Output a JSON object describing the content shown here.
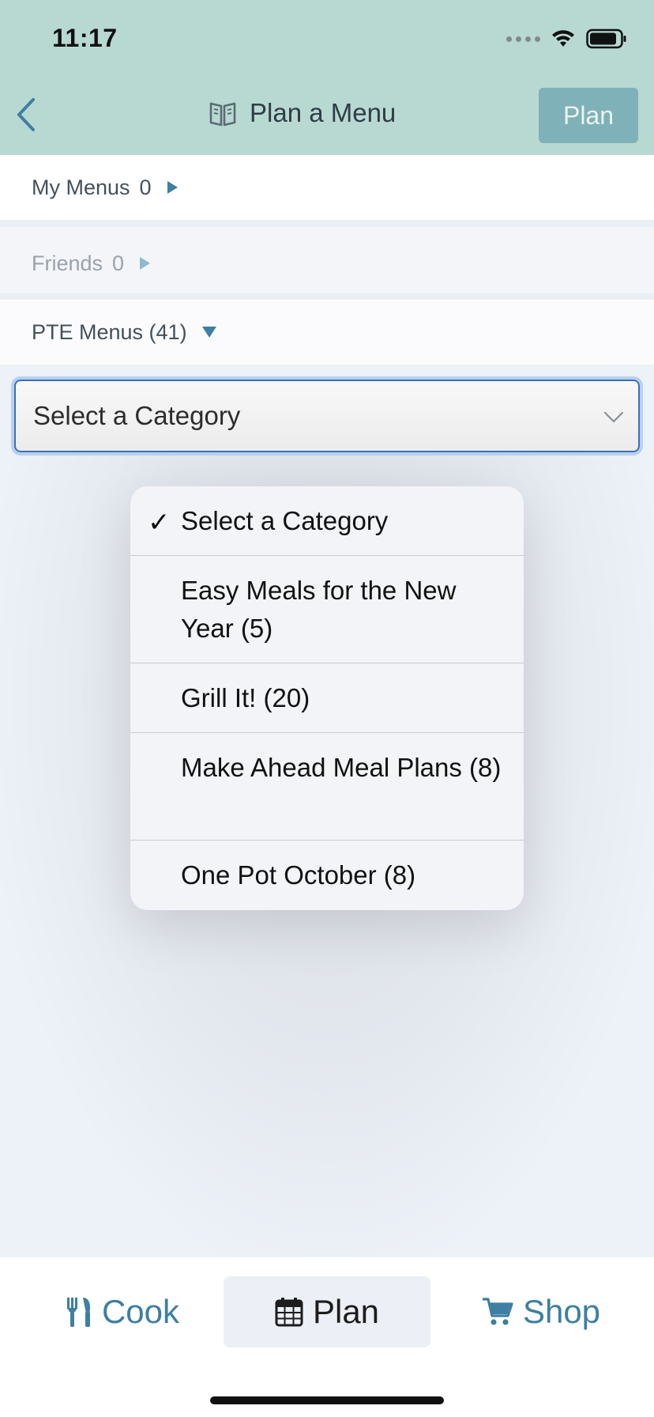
{
  "status_bar": {
    "time": "11:17"
  },
  "nav": {
    "title": "Plan a Menu",
    "plan_button": "Plan"
  },
  "sections": {
    "my_menus": {
      "label": "My Menus",
      "count": "0"
    },
    "friends": {
      "label": "Friends",
      "count": "0"
    },
    "pte_menus": {
      "label": "PTE Menus (41)"
    }
  },
  "category_select": {
    "value": "Select a Category"
  },
  "dropdown": {
    "items": [
      {
        "label": "Select a Category",
        "selected": true
      },
      {
        "label": "Easy Meals for the New Year (5)",
        "selected": false
      },
      {
        "label": "Grill It! (20)",
        "selected": false
      },
      {
        "label": "Make Ahead Meal Plans (8)",
        "selected": false
      },
      {
        "label": "One Pot October (8)",
        "selected": false
      }
    ]
  },
  "tabs": [
    {
      "label": "Cook",
      "icon": "utensils-icon"
    },
    {
      "label": "Plan",
      "icon": "calendar-icon",
      "active": true
    },
    {
      "label": "Shop",
      "icon": "cart-icon"
    }
  ],
  "colors": {
    "header_bg": "#b8d9d2",
    "accent": "#3e7fa3",
    "plan_button_bg": "#7fb1b8"
  }
}
